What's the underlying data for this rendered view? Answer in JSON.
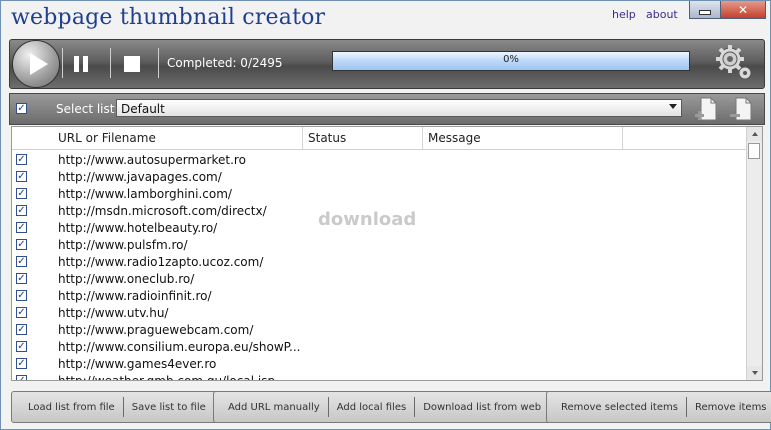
{
  "app": {
    "title": "webpage thumbnail creator",
    "help": "help",
    "about": "about"
  },
  "toolbar": {
    "completed": "Completed: 0/2495",
    "progress_percent": 0,
    "progress_text": "0%"
  },
  "select_list": {
    "label": "Select list:",
    "value": "Default"
  },
  "table": {
    "columns": [
      "URL or Filename",
      "Status",
      "Message"
    ],
    "rows": [
      "http://www.autosupermarket.ro",
      "http://www.javapages.com/",
      "http://www.lamborghini.com/",
      "http://msdn.microsoft.com/directx/",
      "http://www.hotelbeauty.ro/",
      "http://www.pulsfm.ro/",
      "http://www.radio1zapto.ucoz.com/",
      "http://www.oneclub.ro/",
      "http://www.radioinfinit.ro/",
      "http://www.utv.hu/",
      "http://www.praguewebcam.com/",
      "http://www.consilium.europa.eu/showP...",
      "http://www.games4ever.ro",
      "http://weather.gmb.com.gu/local.jsp"
    ],
    "watermark": "download"
  },
  "buttons": {
    "load_list": "Load list from file",
    "save_list": "Save list to file",
    "add_url": "Add URL manually",
    "add_local": "Add local files",
    "download_list": "Download list from web",
    "remove_selected": "Remove selected items",
    "remove_items": "Remove items"
  },
  "icons": {
    "play": "play-icon",
    "pause": "pause-icon",
    "stop": "stop-icon",
    "settings": "gear-icon",
    "new_list": "new-document-icon",
    "delete_list": "delete-document-icon"
  }
}
